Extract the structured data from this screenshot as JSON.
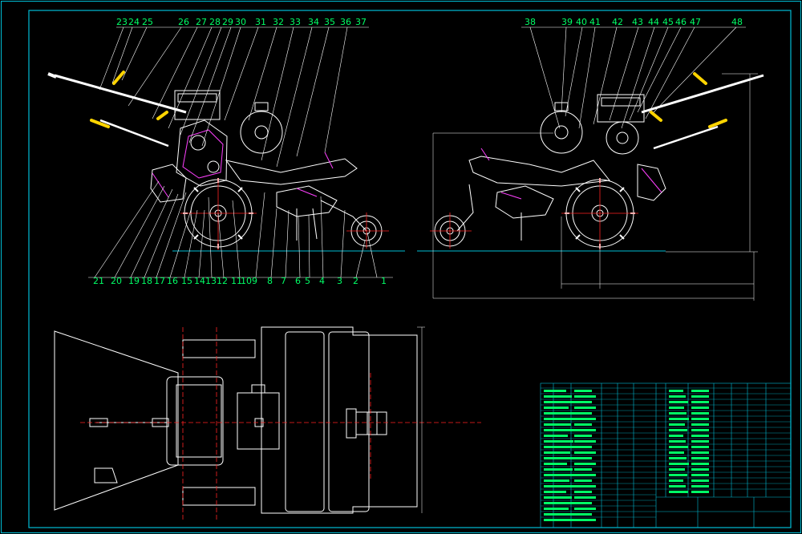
{
  "colors": {
    "background": "#000000",
    "frame": "#00bcd4",
    "geometry": "#ffffff",
    "callouts": "#00ff66",
    "center_lines": "#ff2222",
    "accents": "#ff40ff",
    "handles": "#ffd400"
  },
  "callouts_left_top": [
    "23",
    "24",
    "25",
    "26",
    "27",
    "28",
    "29",
    "30",
    "31",
    "32",
    "33",
    "34",
    "35",
    "36",
    "37"
  ],
  "callouts_left_bottom": [
    "21",
    "20",
    "19",
    "18",
    "17",
    "16",
    "15",
    "14",
    "13",
    "12",
    "11",
    "10",
    "9",
    "8",
    "7",
    "6",
    "5",
    "4",
    "3",
    "2",
    "1"
  ],
  "callouts_right_top": [
    "38",
    "39",
    "40",
    "41",
    "42",
    "43",
    "44",
    "45",
    "46",
    "47",
    "48"
  ],
  "drawing": {
    "views": [
      "left-elevation",
      "right-elevation",
      "plan-view"
    ],
    "parts_table_columns": 2
  }
}
